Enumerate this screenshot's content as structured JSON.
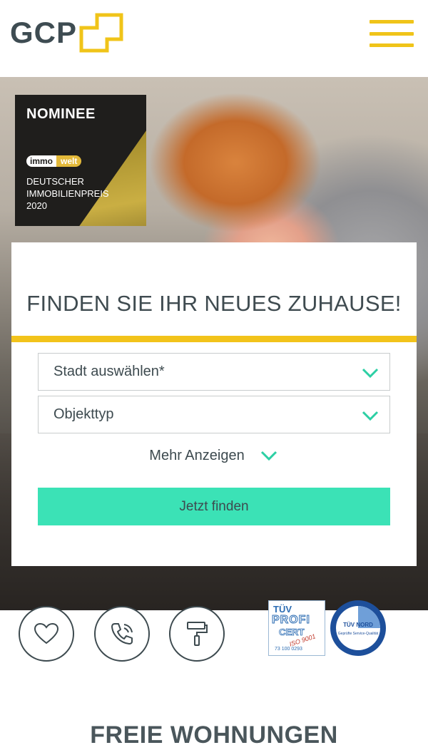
{
  "header": {
    "logo_text": "GCP",
    "menu_icon": "hamburger-menu-icon",
    "accent_color": "#f0c419"
  },
  "hero": {
    "badge": {
      "title": "NOMINEE",
      "logo_left": "immo",
      "logo_right": "welt",
      "line1": "DEUTSCHER",
      "line2": "IMMOBILIENPREIS",
      "line3": "2020"
    }
  },
  "search": {
    "title": "FINDEN SIE IHR NEUES ZUHAUSE!",
    "city_select": "Stadt auswählen*",
    "type_select": "Objekttyp",
    "more_label": "Mehr Anzeigen",
    "submit_label": "Jetzt finden",
    "button_color": "#3be2b6",
    "chevron_color": "#2ccfa4"
  },
  "actions": {
    "favorites_icon": "heart-icon",
    "phone_icon": "phone-icon",
    "renovation_icon": "paint-roller-icon"
  },
  "certificates": {
    "tuv_profi_line1": "TÜV",
    "tuv_profi_line2": "PROFI",
    "tuv_profi_line3": "CERT",
    "tuv_profi_iso": "ISO 9001",
    "tuv_profi_number": "73 100 0293",
    "tuv_nord_label": "TÜV NORD",
    "tuv_nord_ring": "Geprüfte Service-Qualität"
  },
  "section": {
    "title": "FREIE WOHNUNGEN"
  }
}
